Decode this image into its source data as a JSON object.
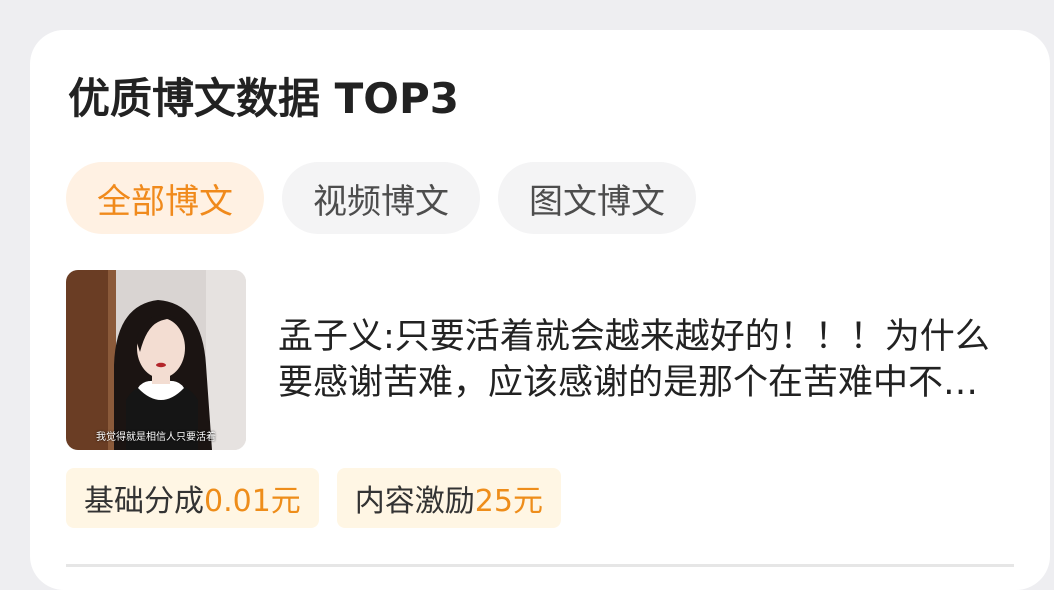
{
  "section": {
    "title": "优质博文数据 TOP3"
  },
  "tabs": [
    {
      "label": "全部博文",
      "active": true
    },
    {
      "label": "视频博文",
      "active": false
    },
    {
      "label": "图文博文",
      "active": false
    }
  ],
  "post": {
    "title": "孟子义:只要活着就会越来越好的！！！为什么要感谢苦难，应该感谢的是那个在苦难中不放弃的自己",
    "thumbnail_caption": "我觉得就是相信人只要活着"
  },
  "stats": [
    {
      "label": "基础分成",
      "value": "0.01元"
    },
    {
      "label": "内容激励",
      "value": "25元"
    }
  ],
  "colors": {
    "accent": "#f08a1c",
    "accent_bg": "#fff1e3",
    "stat_bg": "#fff6e4"
  }
}
